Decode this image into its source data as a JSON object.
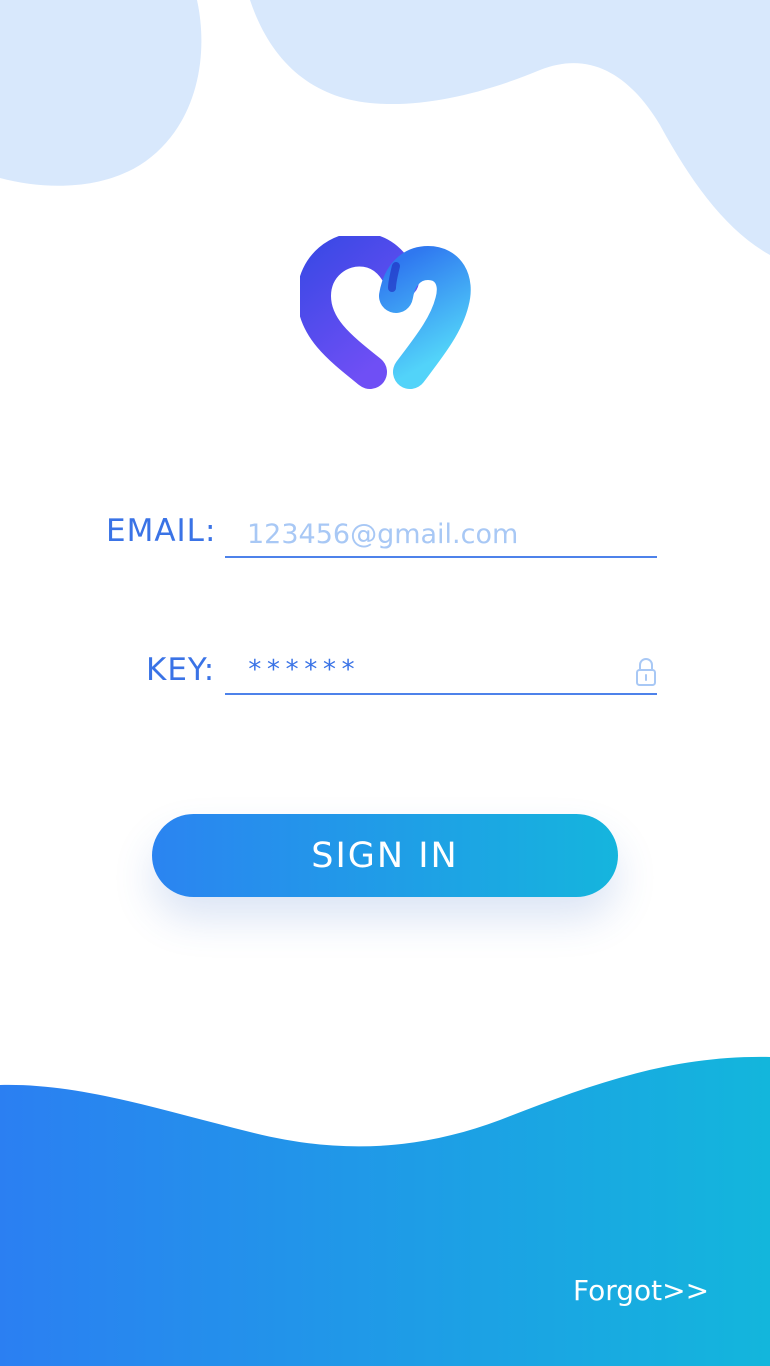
{
  "login": {
    "email_label": "EMAIL:",
    "email_placeholder": "123456@gmail.com",
    "key_label": "KEY:",
    "key_value": "******"
  },
  "actions": {
    "sign_in": "SIGN IN",
    "forgot": "Forgot>>"
  },
  "icons": {
    "logo": "heart-logo-icon",
    "lock": "lock-icon"
  },
  "colors": {
    "accent_blue": "#3a73e6",
    "gradient_start": "#2b84f1",
    "gradient_end": "#15b5dd",
    "blob_light": "#d8e8fc",
    "logo_purple": "#6a4ef0",
    "logo_cyan": "#4fd0f8"
  }
}
